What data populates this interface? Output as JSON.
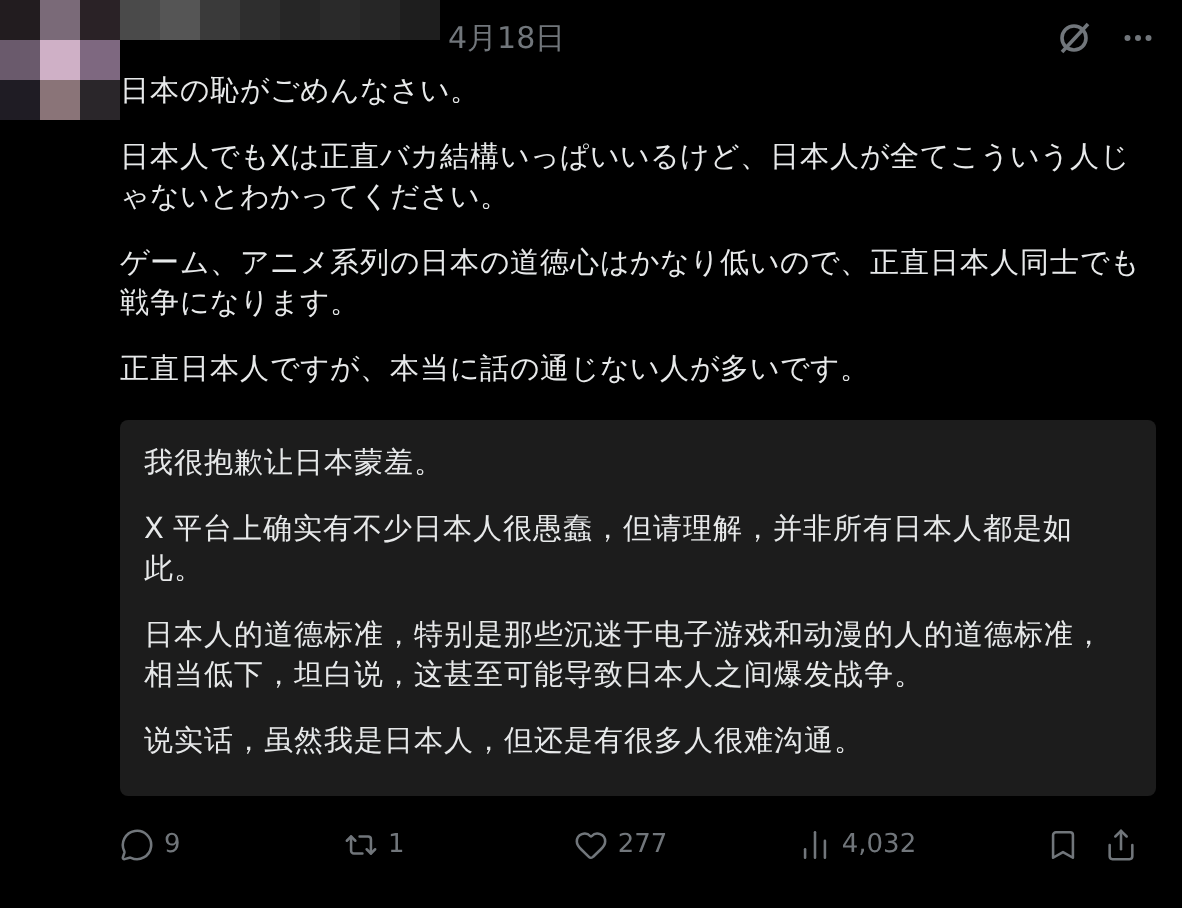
{
  "post": {
    "date": "4月18日",
    "paragraphs": [
      "日本の恥がごめんなさい。",
      "日本人でもXは正直バカ結構いっぱいいるけど、日本人が全てこういう人じゃないとわかってください。",
      "ゲーム、アニメ系列の日本の道徳心はかなり低いので、正直日本人同士でも戦争になります。",
      "正直日本人ですが、本当に話の通じない人が多いです。"
    ],
    "translation": [
      "我很抱歉让日本蒙羞。",
      "X 平台上确实有不少日本人很愚蠢，但请理解，并非所有日本人都是如此。",
      "日本人的道德标准，特别是那些沉迷于电子游戏和动漫的人的道德标准，相当低下，坦白说，这甚至可能导致日本人之间爆发战争。",
      "说实话，虽然我是日本人，但还是有很多人很难沟通。"
    ],
    "actions": [
      {
        "kind": "reply",
        "count": "9"
      },
      {
        "kind": "repost",
        "count": "1"
      },
      {
        "kind": "like",
        "count": "277"
      },
      {
        "kind": "views",
        "count": "4,032"
      },
      {
        "kind": "bookmark"
      },
      {
        "kind": "share"
      }
    ]
  }
}
